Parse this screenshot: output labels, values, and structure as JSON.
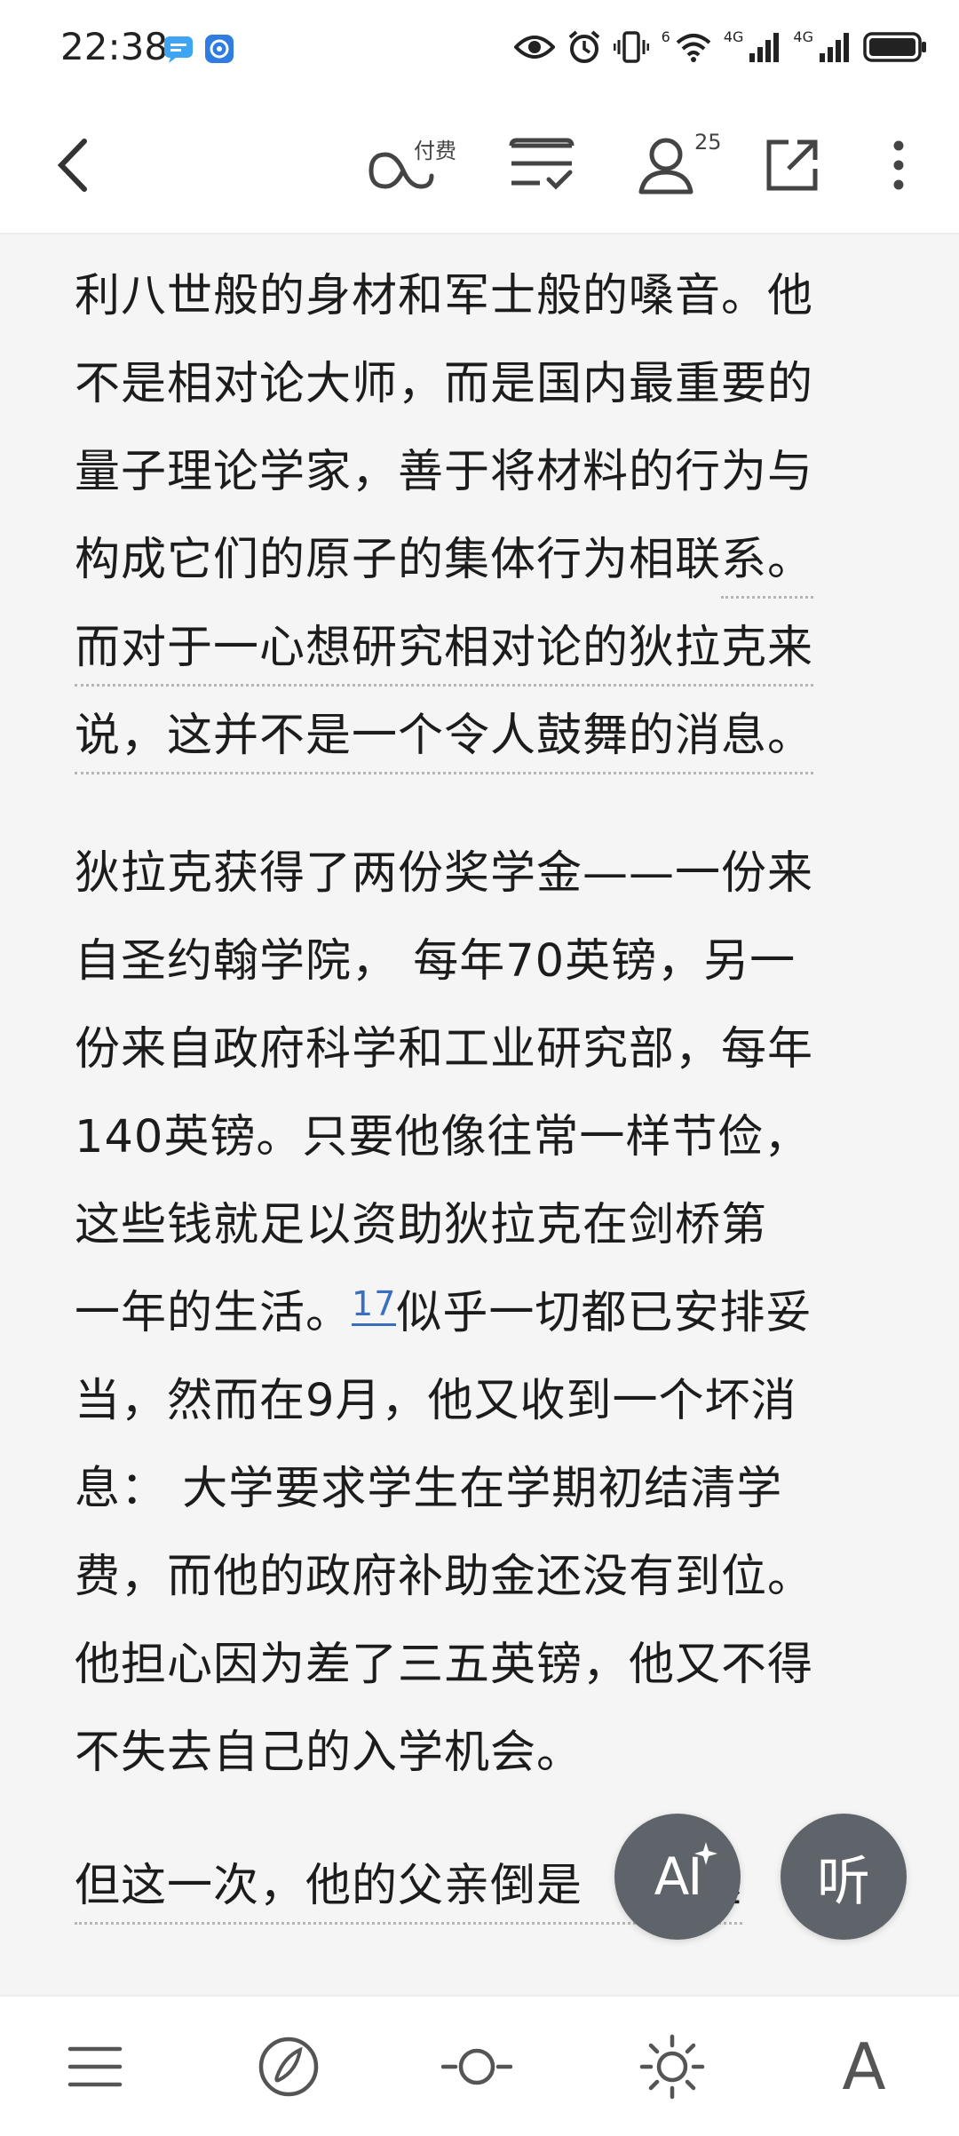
{
  "status_bar": {
    "time": "22:38",
    "network_labels": [
      "6",
      "4G",
      "4G"
    ]
  },
  "toolbar": {
    "paid_badge": "付费",
    "reader_count": "25"
  },
  "paragraphs": [
    {
      "lines": [
        {
          "text": "利八世般的身材和军士般的嗓音。他",
          "underline": false
        },
        {
          "text": "不是相对论大师，而是国内最重要的",
          "underline": false
        },
        {
          "text": "量子理论学家，善于将材料的行为与",
          "underline": false
        },
        {
          "prefix": "构成它们的原子的集体行为相联",
          "text": "系。",
          "underline": true
        },
        {
          "text": "而对于一心想研究相对论的狄拉克来",
          "underline": true
        },
        {
          "text": "说，这并不是一个令人鼓舞的消息。",
          "underline": true
        }
      ]
    },
    {
      "lines": [
        {
          "text": "狄拉克获得了两份奖学金——一份来",
          "underline": false
        },
        {
          "text": "自圣约翰学院， 每年70英镑，另一",
          "underline": false
        },
        {
          "text": "份来自政府科学和工业研究部，每年",
          "underline": false
        },
        {
          "text": "140英镑。只要他像往常一样节俭，",
          "underline": false
        },
        {
          "text": "这些钱就足以资助狄拉克在剑桥第",
          "underline": false
        },
        {
          "text": "一年的生活。",
          "footnote": "17",
          "suffix": "似乎一切都已安排妥",
          "underline": false
        },
        {
          "text": "当，然而在9月，他又收到一个坏消",
          "underline": false
        },
        {
          "text": "息： 大学要求学生在学期初结清学",
          "underline": false
        },
        {
          "text": "费，而他的政府补助金还没有到位。",
          "underline": false
        },
        {
          "text": "他担心因为差了三五英镑，他又不得",
          "underline": false
        },
        {
          "text": "不失去自己的入学机会。",
          "underline": false
        }
      ]
    },
    {
      "lines": [
        {
          "text": "但这一次，他的父亲倒是",
          "tail": "拯",
          "underline": true
        }
      ]
    }
  ],
  "fab": {
    "ai_label": "AI",
    "listen_label": "听"
  },
  "bottom_bar": {
    "font_label": "A"
  },
  "colors": {
    "page_bg": "#f5f5f5",
    "fab_bg": "#5f646b",
    "footnote": "#3a6fbf"
  }
}
